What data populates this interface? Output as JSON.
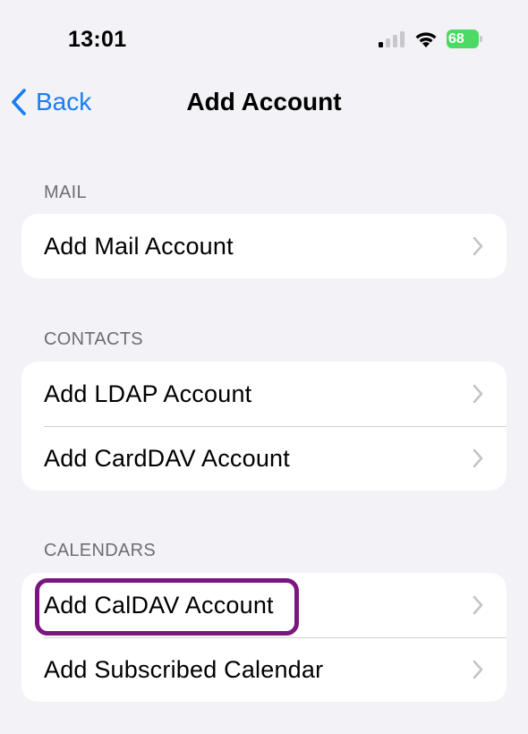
{
  "status_bar": {
    "time": "13:01",
    "battery_percent": "68"
  },
  "nav": {
    "back_label": "Back",
    "title": "Add Account"
  },
  "sections": [
    {
      "header": "MAIL",
      "rows": [
        {
          "label": "Add Mail Account"
        }
      ]
    },
    {
      "header": "CONTACTS",
      "rows": [
        {
          "label": "Add LDAP Account"
        },
        {
          "label": "Add CardDAV Account"
        }
      ]
    },
    {
      "header": "CALENDARS",
      "rows": [
        {
          "label": "Add CalDAV Account"
        },
        {
          "label": "Add Subscribed Calendar"
        }
      ]
    }
  ],
  "colors": {
    "accent": "#1a7ef2",
    "highlight": "#7a167f",
    "battery": "#4cd964",
    "background": "#f2f2f7"
  }
}
